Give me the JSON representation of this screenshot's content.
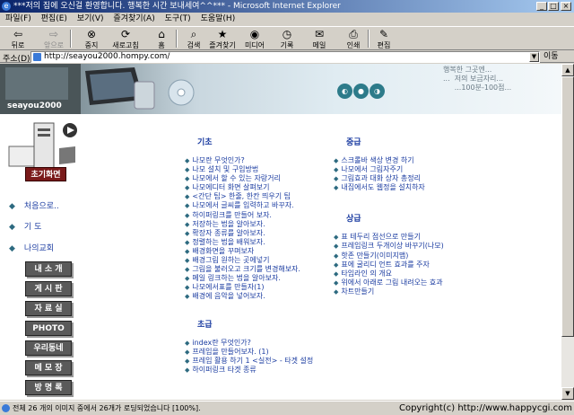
{
  "window": {
    "title": "***저의 집에 오신걸 환영합니다. 행복한 시간 보내세여^^*** - Microsoft Internet Explorer",
    "min": "_",
    "max": "□",
    "close": "×"
  },
  "menu": [
    "파일(F)",
    "편집(E)",
    "보기(V)",
    "즐겨찾기(A)",
    "도구(T)",
    "도움말(H)"
  ],
  "toolbar": [
    {
      "icon": "back-icon",
      "label": "뒤로",
      "disabled": false,
      "glyph": "⇦"
    },
    {
      "icon": "forward-icon",
      "label": "앞으로",
      "disabled": true,
      "glyph": "⇨"
    },
    {
      "icon": "stop-icon",
      "label": "중지",
      "disabled": false,
      "glyph": "⊗"
    },
    {
      "icon": "refresh-icon",
      "label": "새로고침",
      "disabled": false,
      "glyph": "⟳"
    },
    {
      "icon": "home-icon",
      "label": "홈",
      "disabled": false,
      "glyph": "⌂"
    },
    {
      "icon": "search-icon",
      "label": "검색",
      "disabled": false,
      "glyph": "⌕"
    },
    {
      "icon": "favorites-icon",
      "label": "즐겨찾기",
      "disabled": false,
      "glyph": "★"
    },
    {
      "icon": "media-icon",
      "label": "미디어",
      "disabled": false,
      "glyph": "◉"
    },
    {
      "icon": "history-icon",
      "label": "기록",
      "disabled": false,
      "glyph": "◷"
    },
    {
      "icon": "mail-icon",
      "label": "메일",
      "disabled": false,
      "glyph": "✉"
    },
    {
      "icon": "print-icon",
      "label": "인쇄",
      "disabled": false,
      "glyph": "⎙"
    },
    {
      "icon": "edit-icon",
      "label": "편집",
      "disabled": false,
      "glyph": "✎"
    }
  ],
  "address": {
    "label": "주소(D)",
    "url": "http://seayou2000.hompy.com/",
    "go": "이동"
  },
  "banner": {
    "logo": "seayou2000",
    "header_text": "행복한 그곳엔...\n...  저의 보금자리...\n     ...100분-100점..."
  },
  "sidebar": {
    "intro": "초기화면",
    "links": [
      "처음으로..",
      "기 도",
      "나의교회"
    ],
    "menu": [
      "내 소 개",
      "게 시 판",
      "자 료 실",
      "PHOTO",
      "우리동네",
      "메 모 장",
      "방 명 록"
    ]
  },
  "main": {
    "basic": {
      "title": "기초",
      "items": [
        "나모란 무엇인가?",
        "나모 설치 및 구입방법",
        "나모에서 할 수 있는 자랑거리",
        "나모에디터 화면 살펴보기",
        "<간단 팁> 한줄, 한칸 띄우기 팁",
        "나모에서 글씨를 입력하고 바꾸자.",
        "하이퍼링크를 만들어 보자.",
        "저장하는 법을 알아보자.",
        "확장자 종류를 알아보자.",
        "정렬하는 법을 배워보자.",
        "배경화면을 꾸며보자",
        "배경그림 원하는 곳에넣기",
        "그림을 불러오고 크기를 변경해보자.",
        "메일 링크하는 법을 알아보자.",
        "나모에서표를 만들자(1)",
        "배경에 음악을 넣어보자."
      ]
    },
    "beginner": {
      "title": "초급",
      "items": [
        "index란 무엇인가?",
        "프레임을 만들어보자. (1)",
        "프레임 활용 하기 1 <실전> - 타겟 설정",
        "하이퍼링크 타겟 종류"
      ]
    },
    "intermediate": {
      "title": "중급",
      "items": [
        "스크롤바 색상 변경 하기",
        "나모에서 그림자주기",
        "그림효과 대화 상자 총정리",
        "내집에서도 웹정을 설치하자"
      ]
    },
    "advanced": {
      "title": "상급",
      "items": [
        "표 테두리 점선으로 만들기",
        "프레임링크 두개이상 바꾸기(나모)",
        "핫존 만들기(이미지맵)",
        "표에 굴리디 언트 효과를 주자",
        "타임라인 의 개요",
        "위에서 아래로 그림 내려오는 효과",
        "차트만들기"
      ]
    }
  },
  "status": {
    "text": "전체 26 개의 이미지 중에서 26개가 로딩되었습니다 [100%].",
    "copyright": "Copyright(c) http://www.happycgi.com"
  }
}
